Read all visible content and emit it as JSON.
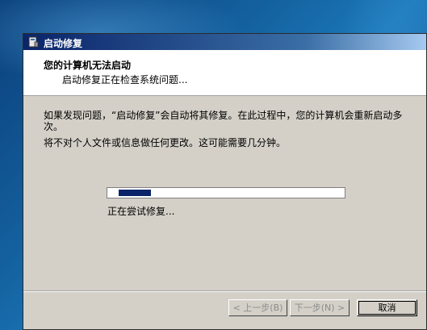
{
  "window": {
    "title": "启动修复"
  },
  "header": {
    "title": "您的计算机无法启动",
    "subtitle": "启动修复正在检查系统问题..."
  },
  "content": {
    "paragraph1": "如果发现问题，“启动修复”会自动将其修复。在此过程中，您的计算机会重新启动多次。",
    "paragraph2": "将不对个人文件或信息做任何更改。这可能需要几分钟。"
  },
  "progress": {
    "indeterminate": true,
    "status": "正在尝试修复..."
  },
  "buttons": {
    "back": "< 上一步(B)",
    "next": "下一步(N) >",
    "cancel": "取消"
  },
  "colors": {
    "titlebar_start": "#0a246a",
    "progress_fill": "#0a246a",
    "dialog_bg": "#d4d0c8"
  },
  "icons": {
    "title_icon": "startup-repair-icon"
  }
}
